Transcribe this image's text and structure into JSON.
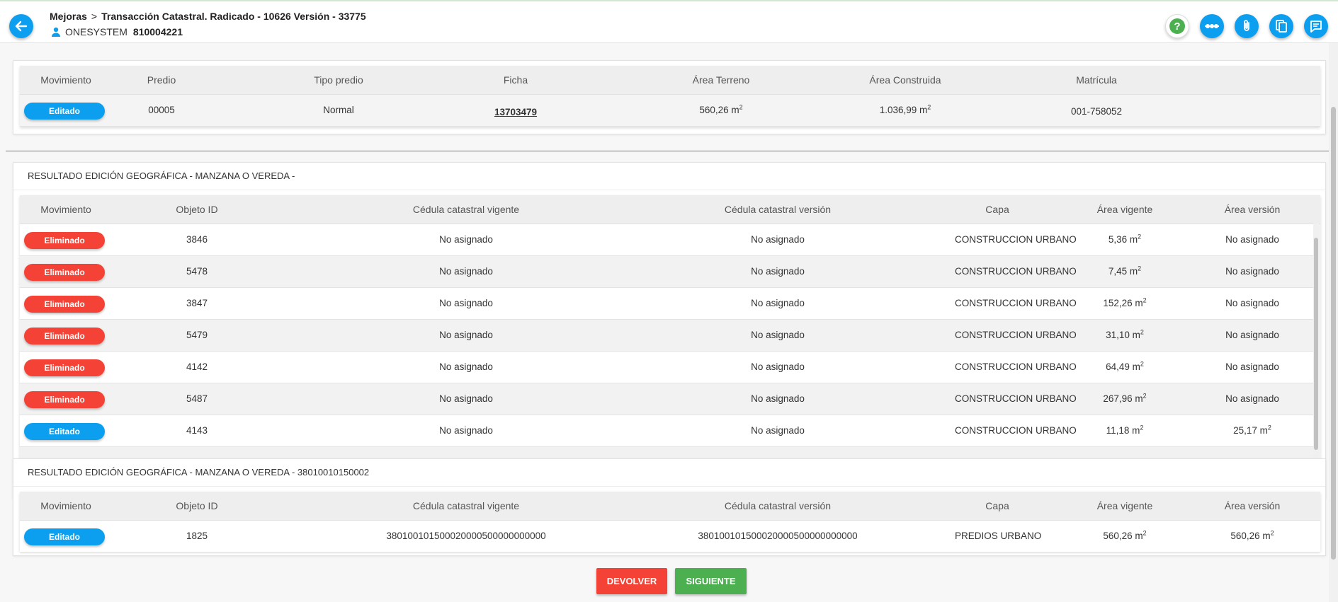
{
  "header": {
    "breadcrumb_root": "Mejoras",
    "breadcrumb_sep": ">",
    "breadcrumb_current": "Transacción Catastral. Radicado - 10626 Versión - 33775",
    "user_name": "ONESYSTEM",
    "user_id": "810004221",
    "icons": [
      "arrow-left-icon",
      "help-icon",
      "flow-icon",
      "paperclip-icon",
      "copy-document-icon",
      "notes-icon"
    ]
  },
  "colors": {
    "accent": "#0c9ff0",
    "editado": "#0c9ff0",
    "eliminado": "#f44336",
    "devolver": "#f44336",
    "siguiente": "#4caf50"
  },
  "predio_table": {
    "headers": [
      "Movimiento",
      "Predio",
      "Tipo predio",
      "Ficha",
      "Área Terreno",
      "Área Construida",
      "Matrícula"
    ],
    "row": {
      "movimiento": "Editado",
      "predio": "00005",
      "tipo_predio": "Normal",
      "ficha": "13703479",
      "area_terreno": "560,26 m",
      "area_construida": "1.036,99 m",
      "matricula": "001-758052"
    }
  },
  "unit_sup": "2",
  "section1": {
    "title": "RESULTADO EDICIÓN GEOGRÁFICA - MANZANA O VEREDA -",
    "headers": [
      "Movimiento",
      "Objeto ID",
      "Cédula catastral vigente",
      "Cédula catastral versión",
      "Capa",
      "Área vigente",
      "Área versión"
    ],
    "rows": [
      {
        "movimiento": "Eliminado",
        "objeto_id": "3846",
        "vigente": "No asignado",
        "version": "No asignado",
        "capa": "CONSTRUCCION URBANO",
        "area_vigente": "5,36 m",
        "area_version": "No asignado"
      },
      {
        "movimiento": "Eliminado",
        "objeto_id": "5478",
        "vigente": "No asignado",
        "version": "No asignado",
        "capa": "CONSTRUCCION URBANO",
        "area_vigente": "7,45 m",
        "area_version": "No asignado"
      },
      {
        "movimiento": "Eliminado",
        "objeto_id": "3847",
        "vigente": "No asignado",
        "version": "No asignado",
        "capa": "CONSTRUCCION URBANO",
        "area_vigente": "152,26 m",
        "area_version": "No asignado"
      },
      {
        "movimiento": "Eliminado",
        "objeto_id": "5479",
        "vigente": "No asignado",
        "version": "No asignado",
        "capa": "CONSTRUCCION URBANO",
        "area_vigente": "31,10 m",
        "area_version": "No asignado"
      },
      {
        "movimiento": "Eliminado",
        "objeto_id": "4142",
        "vigente": "No asignado",
        "version": "No asignado",
        "capa": "CONSTRUCCION URBANO",
        "area_vigente": "64,49 m",
        "area_version": "No asignado"
      },
      {
        "movimiento": "Eliminado",
        "objeto_id": "5487",
        "vigente": "No asignado",
        "version": "No asignado",
        "capa": "CONSTRUCCION URBANO",
        "area_vigente": "267,96 m",
        "area_version": "No asignado"
      },
      {
        "movimiento": "Editado",
        "objeto_id": "4143",
        "vigente": "No asignado",
        "version": "No asignado",
        "capa": "CONSTRUCCION URBANO",
        "area_vigente": "11,18 m",
        "area_version": "25,17 m"
      }
    ]
  },
  "section2": {
    "title": "RESULTADO EDICIÓN GEOGRÁFICA - MANZANA O VEREDA - 38010010150002",
    "headers": [
      "Movimiento",
      "Objeto ID",
      "Cédula catastral vigente",
      "Cédula catastral versión",
      "Capa",
      "Área vigente",
      "Área versión"
    ],
    "rows": [
      {
        "movimiento": "Editado",
        "objeto_id": "1825",
        "vigente": "380100101500020000500000000000",
        "version": "380100101500020000500000000000",
        "capa": "PREDIOS URBANO",
        "area_vigente": "560,26 m",
        "area_version": "560,26 m"
      }
    ]
  },
  "actions": {
    "devolver": "DEVOLVER",
    "siguiente": "SIGUIENTE"
  }
}
